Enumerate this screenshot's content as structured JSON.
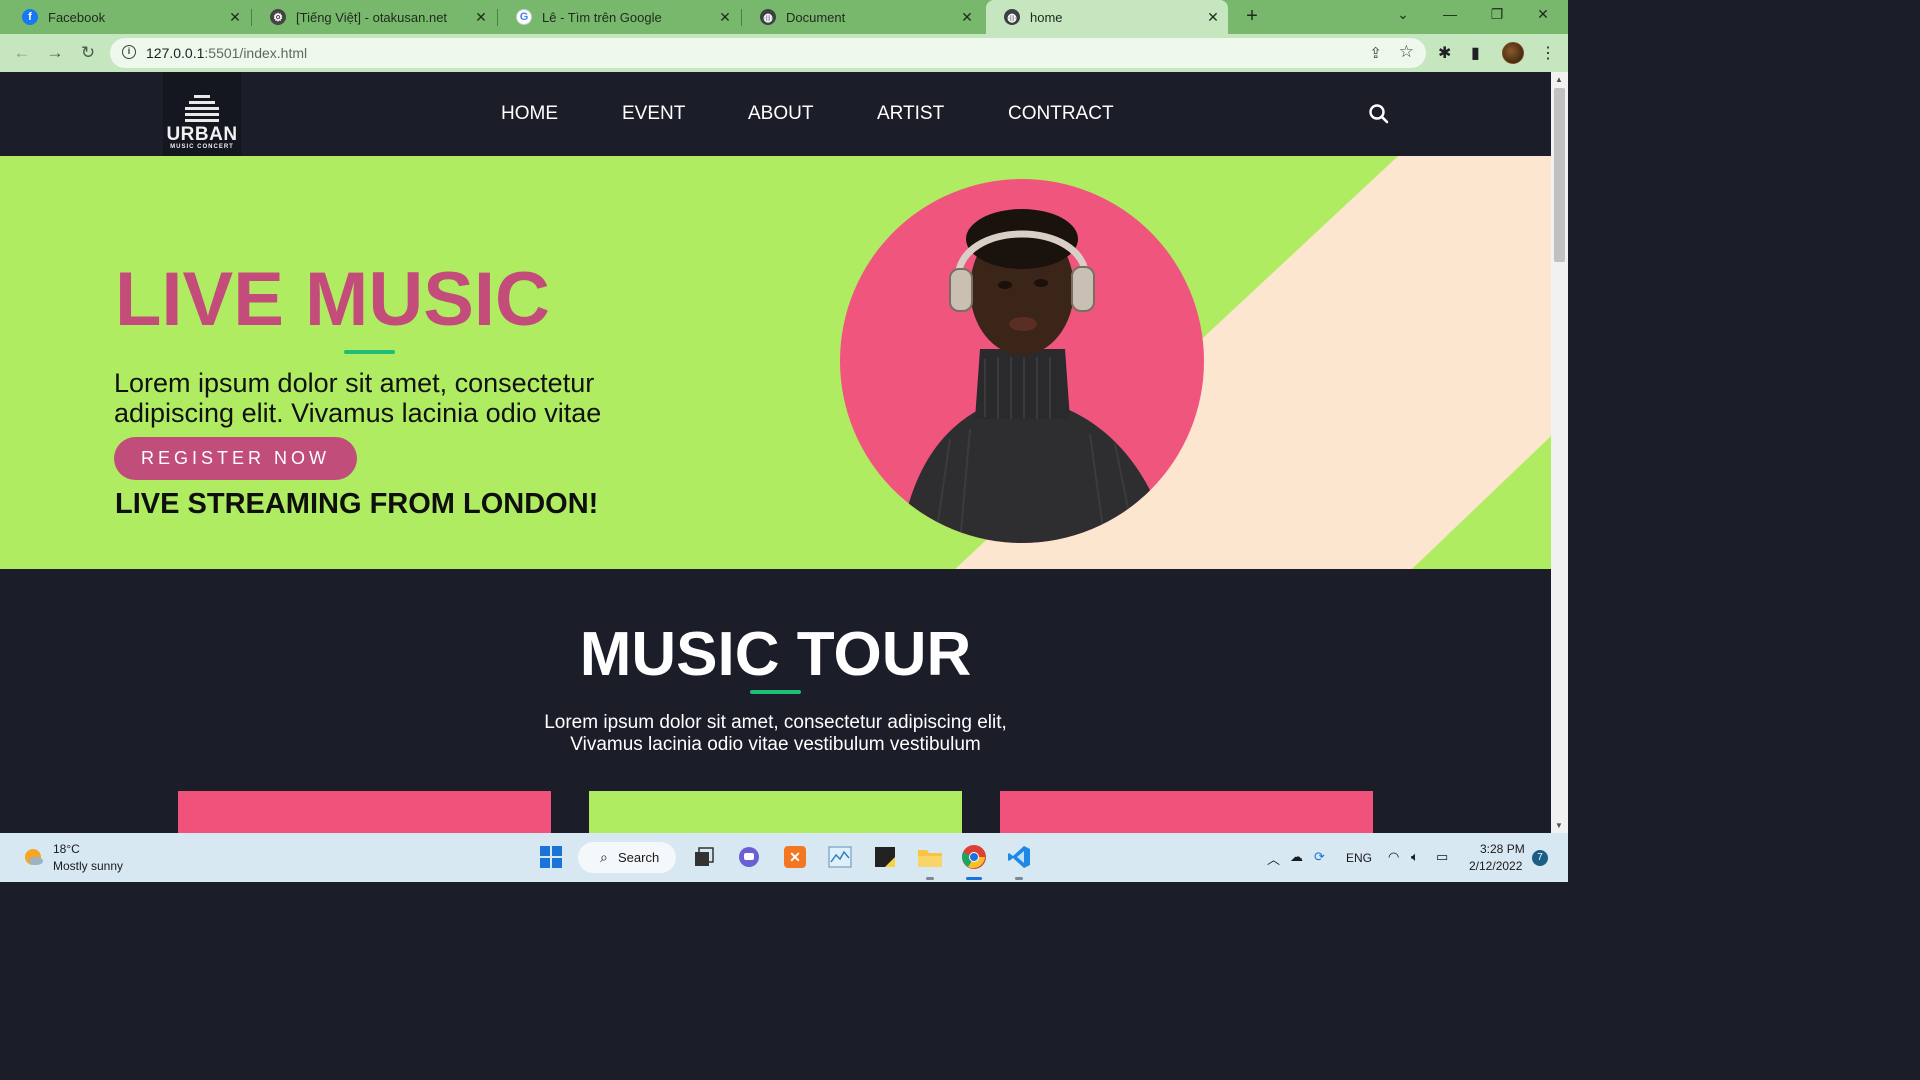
{
  "browser": {
    "tabs": [
      {
        "title": "Facebook",
        "icon": "facebook-icon",
        "active": false
      },
      {
        "title": "[Tiếng Việt] - otakusan.net",
        "icon": "gear-icon",
        "active": false
      },
      {
        "title": "Lê - Tìm trên Google",
        "icon": "google-icon",
        "active": false
      },
      {
        "title": "Document",
        "icon": "globe-icon",
        "active": false
      },
      {
        "title": "home",
        "icon": "globe-icon",
        "active": true
      }
    ],
    "url_host": "127.0.0.1",
    "url_path": ":5501/index.html"
  },
  "site": {
    "logo": {
      "word": "URBAN",
      "sub": "MUSIC CONCERT"
    },
    "nav": [
      "HOME",
      "EVENT",
      "ABOUT",
      "ARTIST",
      "CONTRACT"
    ],
    "hero": {
      "title": "LIVE MUSIC",
      "text": "Lorem ipsum dolor sit amet, consectetur adipiscing elit. Vivamus lacinia odio vitae",
      "button": "REGISTER NOW",
      "stream": "LIVE STREAMING FROM LONDON!"
    },
    "tour": {
      "title": "MUSIC TOUR",
      "text_line1": "Lorem ipsum dolor sit amet, consectetur adipiscing elit,",
      "text_line2": "Vivamus lacinia odio vitae vestibulum vestibulum"
    }
  },
  "colors": {
    "hero_green": "#b0ec62",
    "accent_pink": "#c34c7a",
    "card_pink": "#f1527c",
    "dark_bg": "#1b1d29",
    "rule_green": "#1fbd76"
  },
  "taskbar": {
    "temp": "18°C",
    "weather": "Mostly sunny",
    "search": "Search",
    "lang": "ENG",
    "time": "3:28 PM",
    "date": "2/12/2022",
    "notifications": "7"
  }
}
